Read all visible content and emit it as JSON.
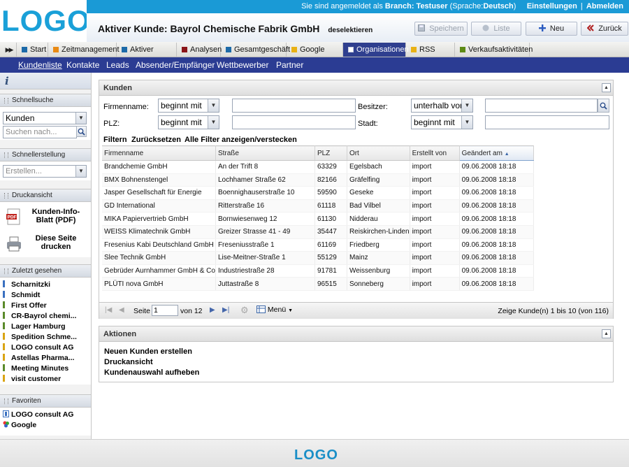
{
  "header": {
    "logo": "LOGO",
    "login_text": "Sie sind angemeldet als",
    "branch_label": "Branch: Testuser",
    "lang_open": "(Sprache:",
    "lang_value": "Deutsch",
    "lang_close": ")",
    "settings": "Einstellungen",
    "separator": "|",
    "logout": "Abmelden",
    "customer_title": "Aktiver Kunde: Bayrol Chemische Fabrik GmbH",
    "deselect": "deselektieren",
    "buttons": {
      "save": "Speichern",
      "list": "Liste",
      "new": "Neu",
      "back": "Zurück"
    }
  },
  "tabs": [
    {
      "label": "Start",
      "color": "#1d6aa8"
    },
    {
      "label": "Zeitmanagement",
      "color": "#e98a14"
    },
    {
      "label": "Aktiver Kunde",
      "color": "#1d6aa8"
    },
    {
      "label": "Analysen",
      "color": "#8a1418"
    },
    {
      "label": "Gesamtgeschäft",
      "color": "#1d6aa8"
    },
    {
      "label": "Google Maps",
      "color": "#e9b114"
    },
    {
      "label": "Organisationen",
      "color": "#ffffff"
    },
    {
      "label": "RSS News",
      "color": "#e9b114"
    },
    {
      "label": "Verkaufsaktivitäten",
      "color": "#5d8a14"
    }
  ],
  "subnav": [
    "Kundenliste",
    "Kontakte",
    "Leads",
    "Absender/Empfänger",
    "Wettbewerber",
    "Partner"
  ],
  "sidebar": {
    "quicksearch": {
      "title": "Schnellsuche",
      "select": "Kunden",
      "placeholder": "Suchen nach..."
    },
    "quickcreate": {
      "title": "Schnellerstellung",
      "placeholder": "Erstellen..."
    },
    "print": {
      "title": "Druckansicht",
      "pdf_label": "Kunden-Info-Blatt (PDF)",
      "print_label": "Diese Seite drucken"
    },
    "recent": {
      "title": "Zuletzt gesehen",
      "items": [
        "Scharnitzki",
        "Schmidt",
        "First Offer",
        "CR-Bayrol chemi...",
        "Lager Hamburg",
        "Spedition Schme...",
        "LOGO consult AG",
        "Astellas Pharma...",
        "Meeting Minutes",
        "visit customer"
      ]
    },
    "favorites": {
      "title": "Favoriten",
      "items": [
        "LOGO consult AG",
        "Google"
      ]
    }
  },
  "kunden": {
    "title": "Kunden",
    "labels": {
      "firmenname": "Firmenname:",
      "besitzer": "Besitzer:",
      "plz": "PLZ:",
      "stadt": "Stadt:"
    },
    "ops": {
      "firmenname": "beginnt mit",
      "besitzer": "unterhalb von",
      "plz": "beginnt mit",
      "stadt": "beginnt mit"
    },
    "links": {
      "filter": "Filtern",
      "reset": "Zurücksetzen",
      "toggle": "Alle Filter anzeigen/verstecken"
    },
    "columns": [
      "Firmenname",
      "Straße",
      "PLZ",
      "Ort",
      "Erstellt von",
      "Geändert am"
    ],
    "rows": [
      [
        "Brandchemie GmbH",
        "An der Trift 8",
        "63329",
        "Egelsbach",
        "import",
        "09.06.2008 18:18"
      ],
      [
        "BMX Bohnenstengel",
        "Lochhamer Straße 62",
        "82166",
        "Gräfelfing",
        "import",
        "09.06.2008 18:18"
      ],
      [
        "Jasper Gesellschaft für Energie",
        "Boennighauserstraße 10",
        "59590",
        "Geseke",
        "import",
        "09.06.2008 18:18"
      ],
      [
        "GD International",
        "Ritterstraße 16",
        "61118",
        "Bad Vilbel",
        "import",
        "09.06.2008 18:18"
      ],
      [
        "MIKA Papiervertrieb GmbH",
        "Bornwiesenweg 12",
        "61130",
        "Nidderau",
        "import",
        "09.06.2008 18:18"
      ],
      [
        "WEISS Klimatechnik GmbH",
        "Greizer Strasse 41 - 49",
        "35447",
        "Reiskirchen-Linden",
        "import",
        "09.06.2008 18:18"
      ],
      [
        "Fresenius Kabi Deutschland GmbH",
        "Freseniusstraße 1",
        "61169",
        "Friedberg",
        "import",
        "09.06.2008 18:18"
      ],
      [
        "Slee Technik GmbH",
        "Lise-Meitner-Straße 1",
        "55129",
        "Mainz",
        "import",
        "09.06.2008 18:18"
      ],
      [
        "Gebrüder Aurnhammer GmbH & Co",
        "Industriestraße 28",
        "91781",
        "Weissenburg",
        "import",
        "09.06.2008 18:18"
      ],
      [
        "PLÜTI nova GmbH",
        "Juttastraße 8",
        "96515",
        "Sonneberg",
        "import",
        "09.06.2008 18:18"
      ]
    ],
    "pager": {
      "page_label": "Seite",
      "page": "1",
      "of": "von 12",
      "menu": "Menü",
      "summary": "Zeige Kunde(n) 1 bis 10 (von 116)"
    }
  },
  "aktionen": {
    "title": "Aktionen",
    "items": [
      "Neuen Kunden erstellen",
      "Druckansicht",
      "Kundenauswahl aufheben"
    ]
  },
  "footer": {
    "logo": "LOGO"
  }
}
